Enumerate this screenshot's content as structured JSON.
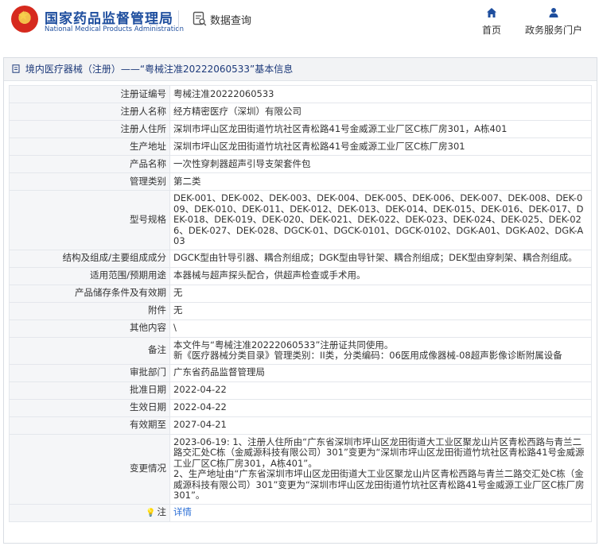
{
  "header": {
    "brand_cn": "国家药品监督管理局",
    "brand_en": "National Medical Products Administration",
    "db_title": "数据查询",
    "nav": [
      {
        "label": "首页",
        "icon": "home-icon"
      },
      {
        "label": "政务服务门户",
        "icon": "user-icon"
      }
    ]
  },
  "breadcrumb": "境内医疗器械（注册）——“粤械注准20222060533”基本信息",
  "rows": [
    {
      "label": "注册证编号",
      "value": "粤械注准20222060533"
    },
    {
      "label": "注册人名称",
      "value": "经方精密医疗（深圳）有限公司"
    },
    {
      "label": "注册人住所",
      "value": "深圳市坪山区龙田街道竹坑社区青松路41号金威源工业厂区C栋厂房301，A栋401"
    },
    {
      "label": "生产地址",
      "value": "深圳市坪山区龙田街道竹坑社区青松路41号金威源工业厂区C栋厂房301"
    },
    {
      "label": "产品名称",
      "value": "一次性穿刺器超声引导支架套件包"
    },
    {
      "label": "管理类别",
      "value": "第二类"
    },
    {
      "label": "型号规格",
      "value": "DEK-001、DEK-002、DEK-003、DEK-004、DEK-005、DEK-006、DEK-007、DEK-008、DEK-009、DEK-010、DEK-011、DEK-012、DEK-013、DEK-014、DEK-015、DEK-016、DEK-017、DEK-018、DEK-019、DEK-020、DEK-021、DEK-022、DEK-023、DEK-024、DEK-025、DEK-026、DEK-027、DEK-028、DGCK-01、DGCK-0101、DGCK-0102、DGK-A01、DGK-A02、DGK-A03"
    },
    {
      "label": "结构及组成/主要组成成分",
      "value": "DGCK型由针导引器、耦合剂组成；DGK型由导针架、耦合剂组成；DEK型由穿刺架、耦合剂组成。"
    },
    {
      "label": "适用范围/预期用途",
      "value": "本器械与超声探头配合，供超声检查或手术用。"
    },
    {
      "label": "产品储存条件及有效期",
      "value": "无"
    },
    {
      "label": "附件",
      "value": "无"
    },
    {
      "label": "其他内容",
      "value": "\\"
    },
    {
      "label": "备注",
      "value": "本文件与“粤械注准20222060533”注册证共同使用。\n新《医疗器械分类目录》管理类别：II类，分类编码：06医用成像器械-08超声影像诊断附属设备"
    },
    {
      "label": "审批部门",
      "value": "广东省药品监督管理局"
    },
    {
      "label": "批准日期",
      "value": "2022-04-22"
    },
    {
      "label": "生效日期",
      "value": "2022-04-22"
    },
    {
      "label": "有效期至",
      "value": "2027-04-21"
    },
    {
      "label": "变更情况",
      "value": "2023-06-19: 1、注册人住所由“广东省深圳市坪山区龙田街道大工业区聚龙山片区青松西路与青兰二路交汇处C栋（金威源科技有限公司）301”变更为“深圳市坪山区龙田街道竹坑社区青松路41号金威源工业厂区C栋厂房301，A栋401”。\n2、生产地址由“广东省深圳市坪山区龙田街道大工业区聚龙山片区青松西路与青兰二路交汇处C栋（金威源科技有限公司）301”变更为“深圳市坪山区龙田街道竹坑社区青松路41号金威源工业厂区C栋厂房301”。"
    }
  ],
  "note": {
    "label": "注",
    "link": "详情"
  }
}
